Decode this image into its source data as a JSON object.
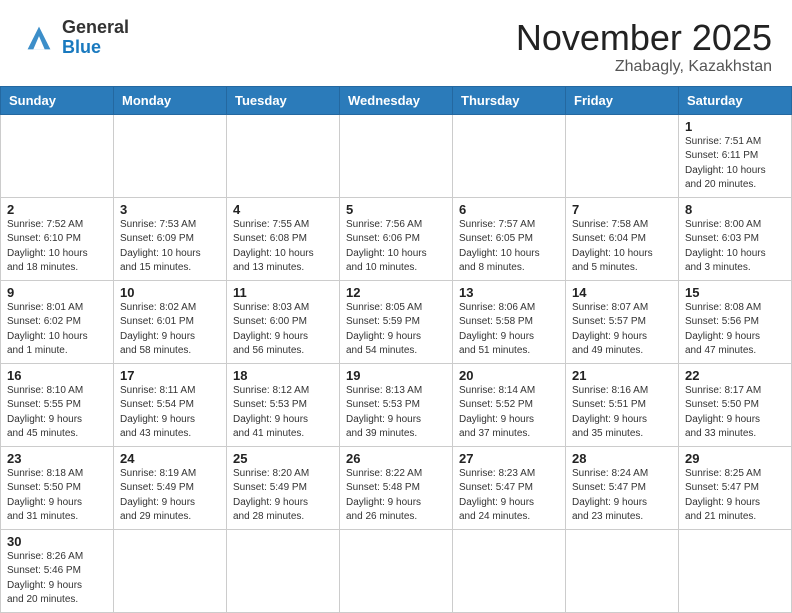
{
  "header": {
    "logo_general": "General",
    "logo_blue": "Blue",
    "month_year": "November 2025",
    "location": "Zhabagly, Kazakhstan"
  },
  "weekdays": [
    "Sunday",
    "Monday",
    "Tuesday",
    "Wednesday",
    "Thursday",
    "Friday",
    "Saturday"
  ],
  "weeks": [
    [
      {
        "day": null,
        "info": null
      },
      {
        "day": null,
        "info": null
      },
      {
        "day": null,
        "info": null
      },
      {
        "day": null,
        "info": null
      },
      {
        "day": null,
        "info": null
      },
      {
        "day": null,
        "info": null
      },
      {
        "day": "1",
        "info": "Sunrise: 7:51 AM\nSunset: 6:11 PM\nDaylight: 10 hours\nand 20 minutes."
      }
    ],
    [
      {
        "day": "2",
        "info": "Sunrise: 7:52 AM\nSunset: 6:10 PM\nDaylight: 10 hours\nand 18 minutes."
      },
      {
        "day": "3",
        "info": "Sunrise: 7:53 AM\nSunset: 6:09 PM\nDaylight: 10 hours\nand 15 minutes."
      },
      {
        "day": "4",
        "info": "Sunrise: 7:55 AM\nSunset: 6:08 PM\nDaylight: 10 hours\nand 13 minutes."
      },
      {
        "day": "5",
        "info": "Sunrise: 7:56 AM\nSunset: 6:06 PM\nDaylight: 10 hours\nand 10 minutes."
      },
      {
        "day": "6",
        "info": "Sunrise: 7:57 AM\nSunset: 6:05 PM\nDaylight: 10 hours\nand 8 minutes."
      },
      {
        "day": "7",
        "info": "Sunrise: 7:58 AM\nSunset: 6:04 PM\nDaylight: 10 hours\nand 5 minutes."
      },
      {
        "day": "8",
        "info": "Sunrise: 8:00 AM\nSunset: 6:03 PM\nDaylight: 10 hours\nand 3 minutes."
      }
    ],
    [
      {
        "day": "9",
        "info": "Sunrise: 8:01 AM\nSunset: 6:02 PM\nDaylight: 10 hours\nand 1 minute."
      },
      {
        "day": "10",
        "info": "Sunrise: 8:02 AM\nSunset: 6:01 PM\nDaylight: 9 hours\nand 58 minutes."
      },
      {
        "day": "11",
        "info": "Sunrise: 8:03 AM\nSunset: 6:00 PM\nDaylight: 9 hours\nand 56 minutes."
      },
      {
        "day": "12",
        "info": "Sunrise: 8:05 AM\nSunset: 5:59 PM\nDaylight: 9 hours\nand 54 minutes."
      },
      {
        "day": "13",
        "info": "Sunrise: 8:06 AM\nSunset: 5:58 PM\nDaylight: 9 hours\nand 51 minutes."
      },
      {
        "day": "14",
        "info": "Sunrise: 8:07 AM\nSunset: 5:57 PM\nDaylight: 9 hours\nand 49 minutes."
      },
      {
        "day": "15",
        "info": "Sunrise: 8:08 AM\nSunset: 5:56 PM\nDaylight: 9 hours\nand 47 minutes."
      }
    ],
    [
      {
        "day": "16",
        "info": "Sunrise: 8:10 AM\nSunset: 5:55 PM\nDaylight: 9 hours\nand 45 minutes."
      },
      {
        "day": "17",
        "info": "Sunrise: 8:11 AM\nSunset: 5:54 PM\nDaylight: 9 hours\nand 43 minutes."
      },
      {
        "day": "18",
        "info": "Sunrise: 8:12 AM\nSunset: 5:53 PM\nDaylight: 9 hours\nand 41 minutes."
      },
      {
        "day": "19",
        "info": "Sunrise: 8:13 AM\nSunset: 5:53 PM\nDaylight: 9 hours\nand 39 minutes."
      },
      {
        "day": "20",
        "info": "Sunrise: 8:14 AM\nSunset: 5:52 PM\nDaylight: 9 hours\nand 37 minutes."
      },
      {
        "day": "21",
        "info": "Sunrise: 8:16 AM\nSunset: 5:51 PM\nDaylight: 9 hours\nand 35 minutes."
      },
      {
        "day": "22",
        "info": "Sunrise: 8:17 AM\nSunset: 5:50 PM\nDaylight: 9 hours\nand 33 minutes."
      }
    ],
    [
      {
        "day": "23",
        "info": "Sunrise: 8:18 AM\nSunset: 5:50 PM\nDaylight: 9 hours\nand 31 minutes."
      },
      {
        "day": "24",
        "info": "Sunrise: 8:19 AM\nSunset: 5:49 PM\nDaylight: 9 hours\nand 29 minutes."
      },
      {
        "day": "25",
        "info": "Sunrise: 8:20 AM\nSunset: 5:49 PM\nDaylight: 9 hours\nand 28 minutes."
      },
      {
        "day": "26",
        "info": "Sunrise: 8:22 AM\nSunset: 5:48 PM\nDaylight: 9 hours\nand 26 minutes."
      },
      {
        "day": "27",
        "info": "Sunrise: 8:23 AM\nSunset: 5:47 PM\nDaylight: 9 hours\nand 24 minutes."
      },
      {
        "day": "28",
        "info": "Sunrise: 8:24 AM\nSunset: 5:47 PM\nDaylight: 9 hours\nand 23 minutes."
      },
      {
        "day": "29",
        "info": "Sunrise: 8:25 AM\nSunset: 5:47 PM\nDaylight: 9 hours\nand 21 minutes."
      }
    ],
    [
      {
        "day": "30",
        "info": "Sunrise: 8:26 AM\nSunset: 5:46 PM\nDaylight: 9 hours\nand 20 minutes."
      },
      {
        "day": null,
        "info": null
      },
      {
        "day": null,
        "info": null
      },
      {
        "day": null,
        "info": null
      },
      {
        "day": null,
        "info": null
      },
      {
        "day": null,
        "info": null
      },
      {
        "day": null,
        "info": null
      }
    ]
  ]
}
